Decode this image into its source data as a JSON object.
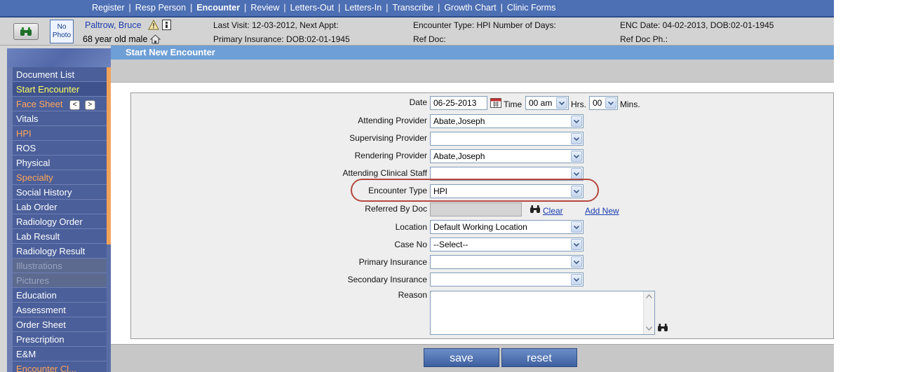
{
  "topnav": {
    "items": [
      {
        "label": "Register"
      },
      {
        "label": "Resp Person"
      },
      {
        "label": "Encounter"
      },
      {
        "label": "Review"
      },
      {
        "label": "Letters-Out"
      },
      {
        "label": "Letters-In"
      },
      {
        "label": "Transcribe"
      },
      {
        "label": "Growth Chart"
      },
      {
        "label": "Clinic Forms"
      }
    ],
    "separator": "|"
  },
  "patient": {
    "photo_label": "No Photo",
    "name": "Paltrow, Bruce",
    "age_sex": "68 year old male",
    "last_visit": "Last Visit: 12-03-2012, Next Appt:",
    "primary_insurance": "Primary Insurance: DOB:02-01-1945",
    "encounter_type": "Encounter Type: HPI Number of Days:",
    "ref_doc": "Ref Doc:",
    "enc_date": "ENC Date: 04-02-2013, DOB:02-01-1945",
    "ref_doc_ph": "Ref Doc Ph.:"
  },
  "sidebar": {
    "items": [
      {
        "label": "Document List"
      },
      {
        "label": "Start Encounter"
      },
      {
        "label": "Face Sheet",
        "prev": "<",
        "next": ">"
      },
      {
        "label": "Vitals"
      },
      {
        "label": "HPI"
      },
      {
        "label": "ROS"
      },
      {
        "label": "Physical"
      },
      {
        "label": "Specialty"
      },
      {
        "label": "Social History"
      },
      {
        "label": "Lab Order"
      },
      {
        "label": "Radiology Order"
      },
      {
        "label": "Lab Result"
      },
      {
        "label": "Radiology Result"
      },
      {
        "label": "Illustrations"
      },
      {
        "label": "Pictures"
      },
      {
        "label": "Education"
      },
      {
        "label": "Assessment"
      },
      {
        "label": "Order Sheet"
      },
      {
        "label": "Prescription"
      },
      {
        "label": "E&M"
      },
      {
        "label": "Encounter Cl..."
      }
    ]
  },
  "main": {
    "title": "Start New Encounter"
  },
  "form": {
    "date_label": "Date",
    "date_value": "06-25-2013",
    "time_label": "Time",
    "hrs_value": "00 am",
    "hrs_label": "Hrs.",
    "mins_value": "00",
    "mins_label": "Mins.",
    "attending_provider_label": "Attending Provider",
    "attending_provider_value": "Abate,Joseph",
    "supervising_provider_label": "Supervising Provider",
    "supervising_provider_value": "",
    "rendering_provider_label": "Rendering Provider",
    "rendering_provider_value": "Abate,Joseph",
    "attending_staff_label": "Attending Clinical Staff",
    "attending_staff_value": "",
    "encounter_type_label": "Encounter Type",
    "encounter_type_value": "HPI",
    "referred_by_label": "Referred By Doc",
    "referred_by_value": "",
    "clear_link": "Clear",
    "add_new_link": "Add New",
    "location_label": "Location",
    "location_value": "Default Working Location",
    "case_no_label": "Case No",
    "case_no_value": "--Select--",
    "primary_insurance_label": "Primary Insurance",
    "primary_insurance_value": "",
    "secondary_insurance_label": "Secondary Insurance",
    "secondary_insurance_value": "",
    "reason_label": "Reason",
    "reason_value": ""
  },
  "buttons": {
    "save": "save",
    "reset": "reset"
  },
  "colors": {
    "nav": "#4d6fb3",
    "title": "#6e9fd6",
    "sidebar": "#4b5f9a",
    "highlight": "#b5483f",
    "button": "#4f71b0"
  }
}
